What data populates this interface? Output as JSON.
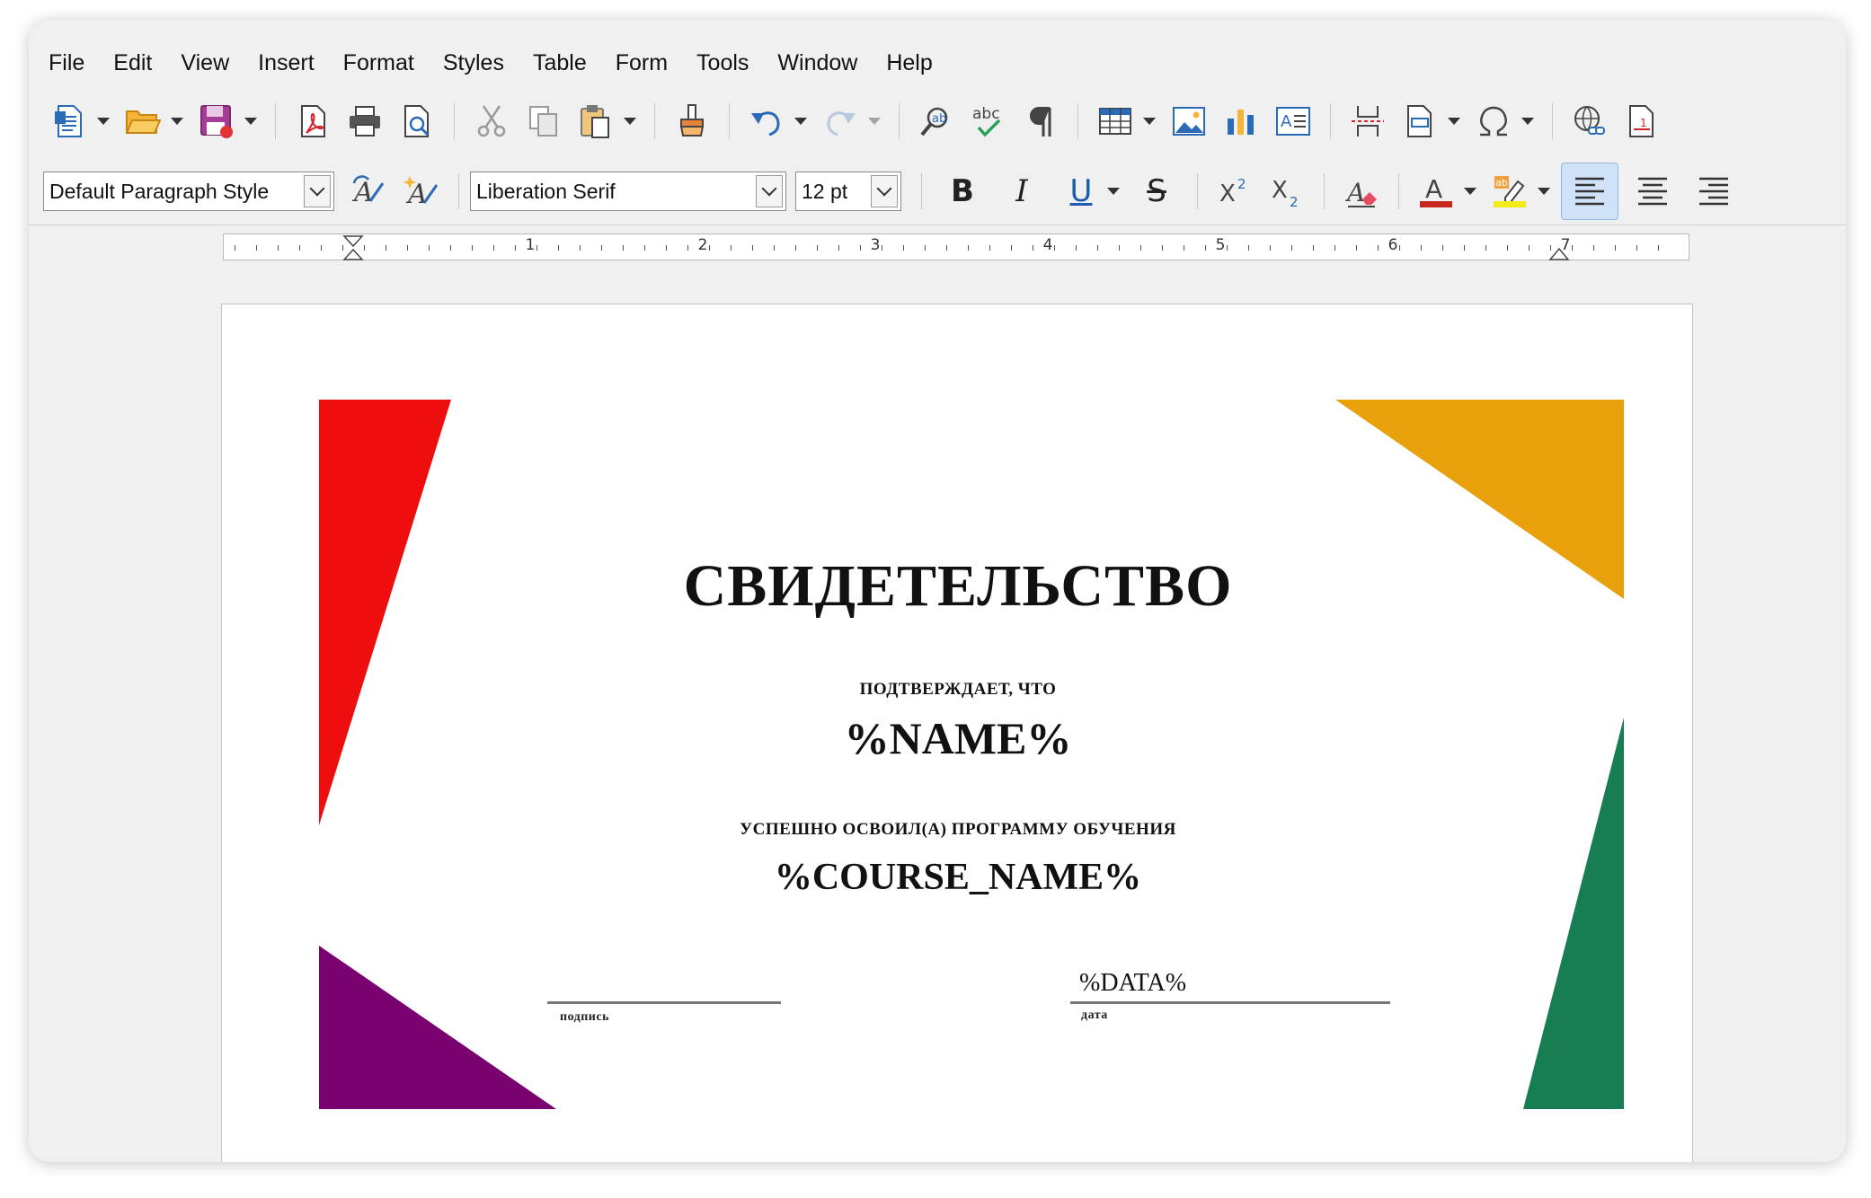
{
  "menu": [
    "File",
    "Edit",
    "View",
    "Insert",
    "Format",
    "Styles",
    "Table",
    "Form",
    "Tools",
    "Window",
    "Help"
  ],
  "formatting": {
    "paragraph_style": "Default Paragraph Style",
    "font_name": "Liberation Serif",
    "font_size": "12 pt",
    "bold": "B",
    "italic": "I",
    "underline": "U",
    "strike": "S"
  },
  "ruler": {
    "numbers": [
      "1",
      "2",
      "3",
      "4",
      "5",
      "6",
      "7"
    ]
  },
  "colors": {
    "red": "#ee0e0e",
    "orange": "#e8a10a",
    "purple": "#7a0270",
    "green": "#177d53",
    "font_color": "#c8261f",
    "highlight": "#f4ea1b"
  },
  "certificate": {
    "title": "СВИДЕТЕЛЬСТВО",
    "confirms": "ПОДТВЕРЖДАЕТ, ЧТО",
    "name": "%NAME%",
    "completed": "УСПЕШНО ОСВОИЛ(А) ПРОГРАММУ ОБУЧЕНИЯ",
    "course": "%COURSE_NAME%",
    "date_value": "%DATA%",
    "signature_label": "подпись",
    "date_label": "дата"
  }
}
